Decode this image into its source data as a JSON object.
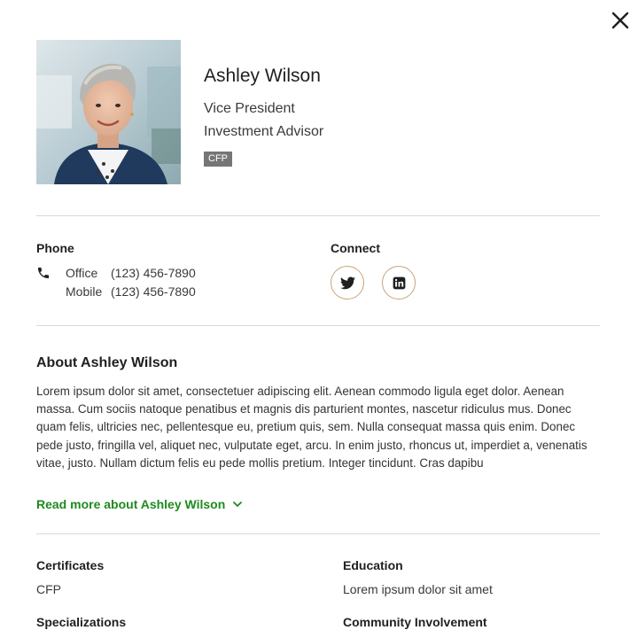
{
  "profile": {
    "name": "Ashley Wilson",
    "title_line1": "Vice President",
    "title_line2": "Investment Advisor",
    "badge": "CFP"
  },
  "contact": {
    "phone_label": "Phone",
    "phones": [
      {
        "type": "Office",
        "number": "(123) 456-7890"
      },
      {
        "type": "Mobile",
        "number": "(123) 456-7890"
      }
    ],
    "connect_label": "Connect",
    "social": [
      {
        "icon": "twitter-icon"
      },
      {
        "icon": "linkedin-icon"
      }
    ]
  },
  "about": {
    "heading": "About Ashley Wilson",
    "body": "Lorem ipsum dolor sit amet, consectetuer adipiscing elit. Aenean commodo ligula eget dolor. Aenean massa. Cum sociis natoque penatibus et magnis dis parturient montes, nascetur ridiculus mus. Donec quam felis, ultricies nec, pellentesque eu, pretium quis, sem. Nulla consequat massa quis enim. Donec pede justo, fringilla vel, aliquet nec, vulputate eget, arcu. In enim justo, rhoncus ut, imperdiet a, venenatis vitae, justo. Nullam dictum felis eu pede mollis pretium. Integer tincidunt. Cras dapibu",
    "read_more": "Read more about Ashley Wilson"
  },
  "details": {
    "certificates_label": "Certificates",
    "certificates_value": "CFP",
    "education_label": "Education",
    "education_value": "Lorem ipsum dolor sit amet",
    "specializations_label": "Specializations",
    "community_label": "Community Involvement"
  },
  "colors": {
    "link_green": "#1e8a1e",
    "badge_gray": "#767676",
    "social_border": "#c9a37a",
    "divider": "#d9d9d9"
  },
  "icons": [
    "close-icon",
    "phone-icon",
    "twitter-icon",
    "linkedin-icon",
    "chevron-down-icon"
  ]
}
